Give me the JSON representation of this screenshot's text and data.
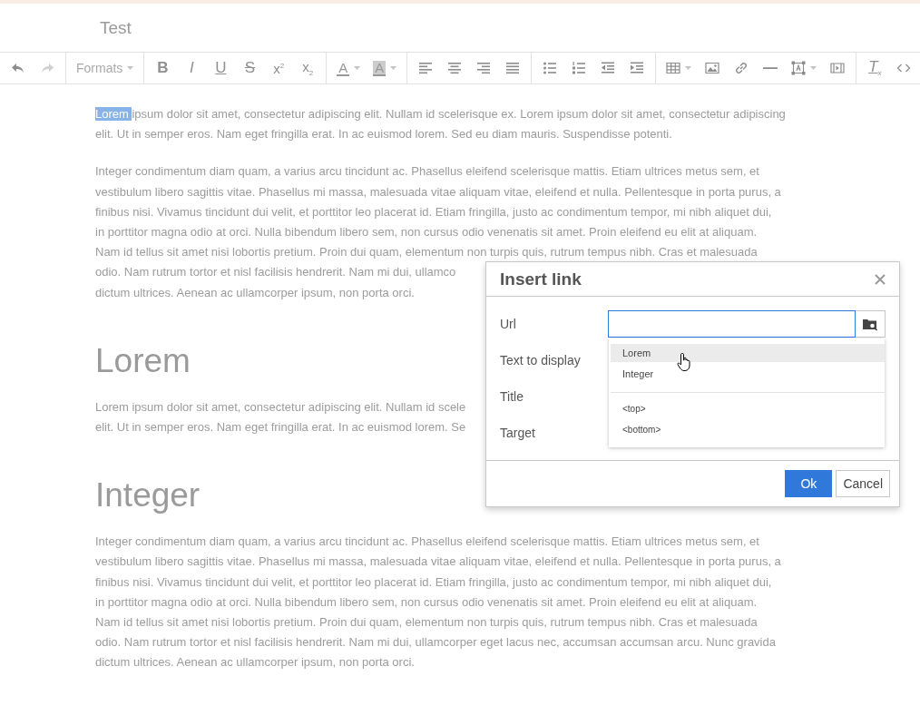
{
  "document_title": "Test",
  "toolbar": {
    "groups": [
      [
        {
          "kind": "undo",
          "disabled": false
        },
        {
          "kind": "redo",
          "disabled": true
        }
      ],
      [
        {
          "kind": "formats",
          "label": "Formats",
          "dropdown": true
        }
      ],
      [
        {
          "kind": "bold",
          "label": "B"
        },
        {
          "kind": "italic",
          "label": "I"
        },
        {
          "kind": "underline",
          "label": "U"
        },
        {
          "kind": "strikethrough",
          "label": "S"
        },
        {
          "kind": "superscript",
          "label": "x$^{2}$"
        },
        {
          "kind": "subscript",
          "label": "x$_{2}$"
        }
      ],
      [
        {
          "kind": "text-color",
          "label": "A",
          "dropdown": true
        },
        {
          "kind": "background-color",
          "label": "A",
          "dropdown": true
        }
      ],
      [
        {
          "kind": "align-left"
        },
        {
          "kind": "align-center"
        },
        {
          "kind": "align-right"
        },
        {
          "kind": "justify"
        }
      ],
      [
        {
          "kind": "bullet-list"
        },
        {
          "kind": "numbered-list"
        },
        {
          "kind": "outdent"
        },
        {
          "kind": "indent"
        }
      ],
      [
        {
          "kind": "table",
          "dropdown": true
        },
        {
          "kind": "image"
        },
        {
          "kind": "link"
        },
        {
          "kind": "horizontal-rule"
        },
        {
          "kind": "textbox",
          "dropdown": true
        },
        {
          "kind": "media"
        }
      ],
      [
        {
          "kind": "clear-format",
          "label": "T$_{x}$"
        },
        {
          "kind": "code"
        }
      ]
    ]
  },
  "content": [
    {
      "kind": "paragraph",
      "selection": "Lorem ",
      "lines": [
        "ipsum dolor sit amet, consectetur adipiscing elit. Nullam id scelerisque ex. Lorem ipsum dolor sit amet, consectetur adipiscing",
        "elit. Ut in semper eros. Nam eget fringilla erat. In ac euismod lorem. Sed eu diam mauris. Suspendisse potenti."
      ]
    },
    {
      "kind": "paragraph",
      "lines": [
        "Integer condimentum diam quam, a varius arcu tincidunt ac. Phasellus eleifend scelerisque mattis. Etiam ultrices metus sem, et",
        "vestibulum libero sagittis vitae. Phasellus mi massa, malesuada vitae aliquam vitae, eleifend et nulla. Pellentesque in porta purus, a",
        "finibus nisi. Vivamus tincidunt dui velit, et porttitor leo placerat id. Etiam fringilla, justo ac condimentum tempor, mi nibh aliquet dui,",
        "in porttitor magna odio at orci. Nulla bibendum libero sem, non cursus odio venenatis sit amet. Proin eleifend eu elit at aliquam.",
        "Nam id tellus sit amet nisi lobortis pretium. Proin dui quam, elementum non turpis quis, rutrum tempus nibh. Cras et malesuada",
        "odio. Nam rutrum tortor et nisl facilisis hendrerit. Nam mi dui, ullamco",
        "dictum ultrices. Aenean ac ullamcorper ipsum, non porta orci."
      ]
    },
    {
      "kind": "heading",
      "lines": [
        "Lorem"
      ]
    },
    {
      "kind": "paragraph",
      "lines": [
        "Lorem ipsum dolor sit amet, consectetur adipiscing elit. Nullam id scele",
        "elit. Ut in semper eros. Nam eget fringilla erat. In ac euismod lorem. Se"
      ]
    },
    {
      "kind": "heading",
      "lines": [
        "Integer"
      ]
    },
    {
      "kind": "paragraph",
      "lines": [
        "Integer condimentum diam quam, a varius arcu tincidunt ac. Phasellus eleifend scelerisque mattis. Etiam ultrices metus sem, et",
        "vestibulum libero sagittis vitae. Phasellus mi massa, malesuada vitae aliquam vitae, eleifend et nulla. Pellentesque in porta purus, a",
        "finibus nisi. Vivamus tincidunt dui velit, et porttitor leo placerat id. Etiam fringilla, justo ac condimentum tempor, mi nibh aliquet dui,",
        "in porttitor magna odio at orci. Nulla bibendum libero sem, non cursus odio venenatis sit amet. Proin eleifend eu elit at aliquam.",
        "Nam id tellus sit amet nisi lobortis pretium. Proin dui quam, elementum non turpis quis, rutrum tempus nibh. Cras et malesuada",
        "odio. Nam rutrum tortor et nisl facilisis hendrerit. Nam mi dui, ullamcorper eget lacus nec, accumsan accumsan arcu. Nunc gravida",
        "dictum ultrices. Aenean ac ullamcorper ipsum, non porta orci."
      ]
    }
  ],
  "dialog": {
    "title": "Insert link",
    "fields": [
      {
        "label": "Url",
        "focused": true
      },
      {
        "label": "Text to display"
      },
      {
        "label": "Title"
      },
      {
        "label": "Target"
      }
    ],
    "suggestions": [
      {
        "kind": "item",
        "label": "Lorem",
        "selected": true
      },
      {
        "kind": "item",
        "label": "Integer",
        "selected": false
      },
      {
        "kind": "divider"
      },
      {
        "kind": "anchor",
        "label": "<top>",
        "selected": false
      },
      {
        "kind": "anchor",
        "label": "<bottom>",
        "selected": false
      }
    ],
    "buttons": [
      {
        "label": "Ok",
        "primary": true
      },
      {
        "label": "Cancel",
        "primary": false
      }
    ]
  }
}
